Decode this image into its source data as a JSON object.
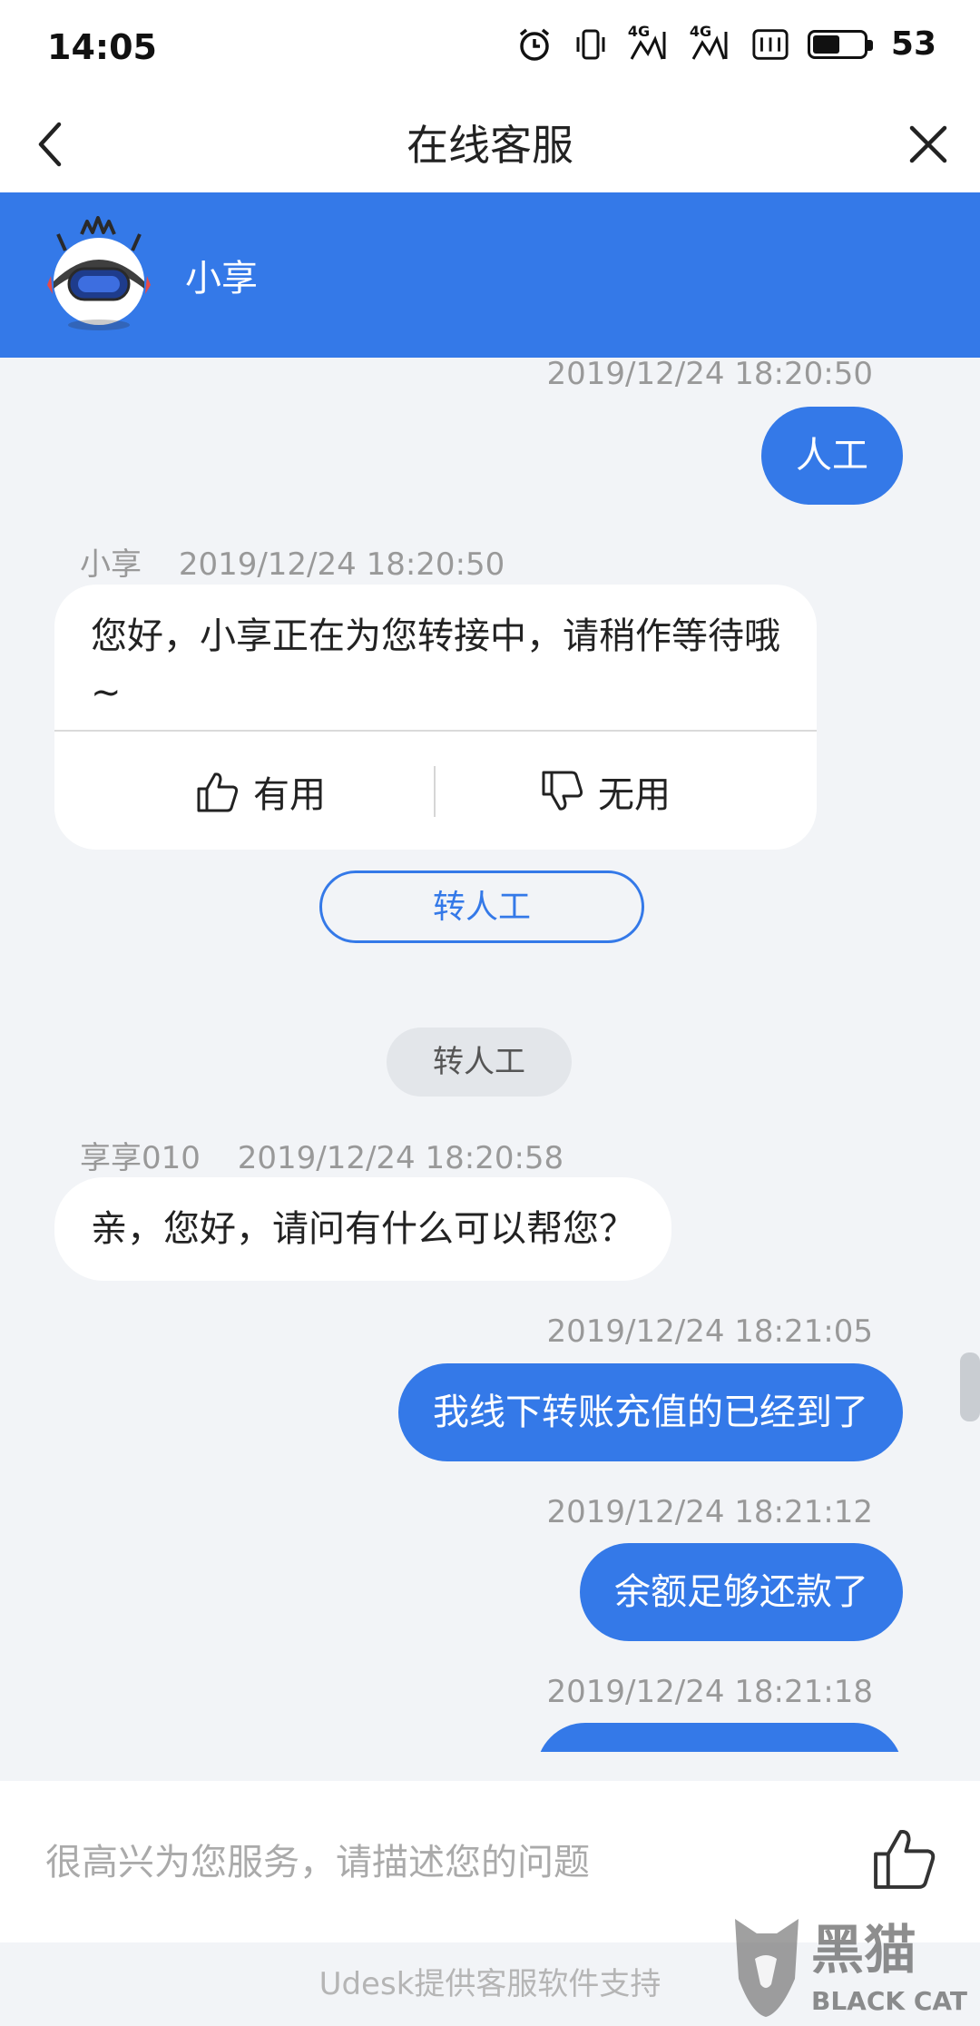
{
  "status_bar": {
    "time": "14:05",
    "network1": "4G",
    "network2": "4G",
    "battery_level": "53",
    "battery_fraction": 0.53
  },
  "title_bar": {
    "title": "在线客服"
  },
  "agent_header": {
    "name": "小享",
    "background": "#3479e8"
  },
  "messages": {
    "m1": {
      "timestamp": "2019/12/24 18:20:50",
      "text": "人工"
    },
    "m2": {
      "sender": "小享",
      "timestamp": "2019/12/24 18:20:50",
      "text": "您好，小享正在为您转接中，请稍作等待哦~",
      "useful_label": "有用",
      "useless_label": "无用"
    },
    "transfer_button": "转人工",
    "system_notice": "转人工",
    "m3": {
      "sender": "享享010",
      "timestamp": "2019/12/24 18:20:58",
      "text": "亲，您好，请问有什么可以帮您？"
    },
    "m4": {
      "timestamp": "2019/12/24 18:21:05",
      "text": "我线下转账充值的已经到了"
    },
    "m5": {
      "timestamp": "2019/12/24 18:21:12",
      "text": "余额足够还款了"
    },
    "m6": {
      "timestamp": "2019/12/24 18:21:18"
    }
  },
  "input": {
    "placeholder": "很高兴为您服务，请描述您的问题",
    "value": ""
  },
  "footer": {
    "text": "Udesk提供客服软件支持"
  },
  "watermark": {
    "brand_cn": "黑猫",
    "brand_en": "BLACK CAT"
  },
  "colors": {
    "accent": "#3479e8",
    "chat_background": "#f2f4f7"
  },
  "icons": [
    "back-arrow-icon",
    "close-icon",
    "robot-avatar",
    "thumbs-up-icon",
    "thumbs-down-icon",
    "alarm-icon",
    "vibrate-icon",
    "signal-icon",
    "battery-icon"
  ]
}
